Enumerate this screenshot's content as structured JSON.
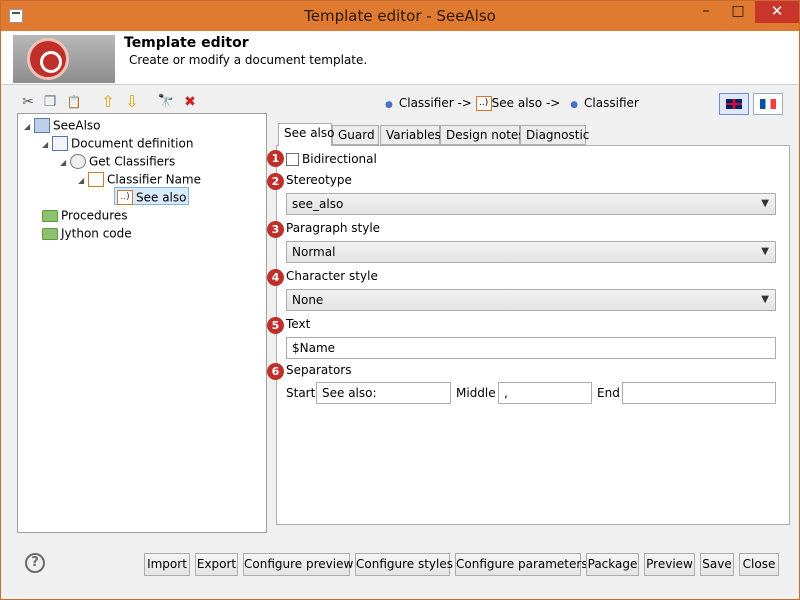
{
  "window": {
    "title": "Template editor - SeeAlso",
    "min": "–",
    "max": "□",
    "close": "✕"
  },
  "header": {
    "title": "Template editor",
    "subtitle": "Create or modify a document template."
  },
  "toolbar": {
    "icons": [
      "scissors-icon",
      "copy-icon",
      "paste-icon",
      "arrow-up-icon",
      "arrow-down-icon",
      "binoculars-icon",
      "delete-icon"
    ],
    "glyphs": [
      "✂",
      "❐",
      "📋",
      "⇧",
      "⇩",
      "🔭",
      "✖"
    ]
  },
  "tree": {
    "root": "SeeAlso",
    "document_definition": "Document definition",
    "get_classifiers": "Get Classifiers",
    "classifier_name": "Classifier Name",
    "see_also": "See also",
    "see_also_icon": "..)",
    "procedures": "Procedures",
    "jython": "Jython code"
  },
  "breadcrumb": {
    "part1": "Classifier ->",
    "icon": "..)",
    "part2": "See also ->",
    "part3": "Classifier"
  },
  "tabs": [
    "See also",
    "Guard",
    "Variables",
    "Design notes",
    "Diagnostic"
  ],
  "form": {
    "badges": [
      "1",
      "2",
      "3",
      "4",
      "5",
      "6"
    ],
    "bidirectional_label": "Bidirectional",
    "stereotype_label": "Stereotype",
    "stereotype_value": "see_also",
    "paragraph_label": "Paragraph style",
    "paragraph_value": "Normal",
    "character_label": "Character style",
    "character_value": "None",
    "text_label": "Text",
    "text_value": "$Name",
    "separators_label": "Separators",
    "start_label": "Start",
    "start_value": "See also:",
    "middle_label": "Middle",
    "middle_value": ",",
    "end_label": "End",
    "end_value": ""
  },
  "buttons": {
    "help": "?",
    "import": "Import",
    "export": "Export",
    "configure_preview": "Configure preview",
    "configure_styles": "Configure styles",
    "configure_parameters": "Configure parameters",
    "package": "Package",
    "preview": "Preview",
    "save": "Save",
    "close": "Close"
  }
}
